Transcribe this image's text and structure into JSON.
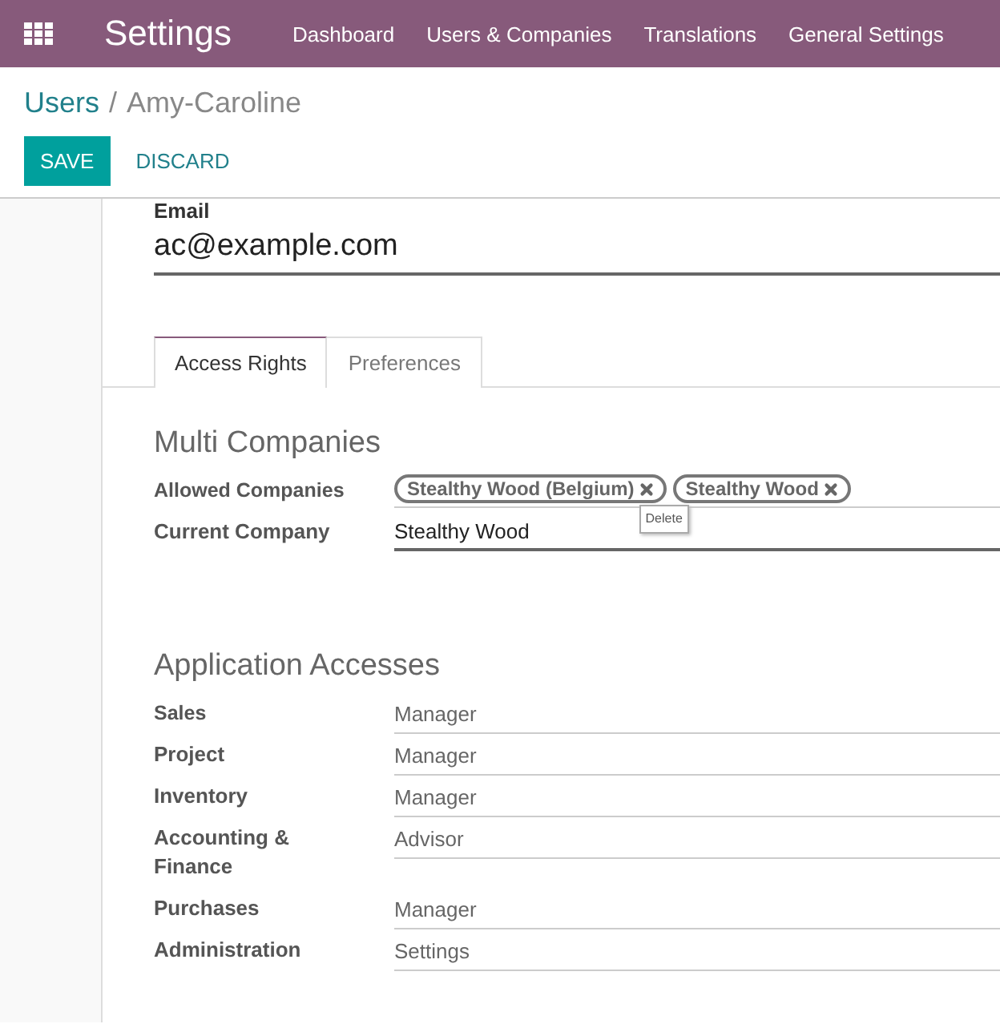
{
  "navbar": {
    "app_title": "Settings",
    "menu": [
      "Dashboard",
      "Users & Companies",
      "Translations",
      "General Settings"
    ]
  },
  "breadcrumb": {
    "parent": "Users",
    "separator": "/",
    "current": "Amy-Caroline"
  },
  "buttons": [
    {
      "label": "SAVE",
      "kind": "primary"
    },
    {
      "label": "DISCARD",
      "kind": "link"
    }
  ],
  "email": {
    "label": "Email",
    "value": "ac@example.com"
  },
  "tabs": [
    {
      "label": "Access Rights",
      "selected": true
    },
    {
      "label": "Preferences",
      "selected": false
    }
  ],
  "sections": [
    {
      "title": "Multi Companies",
      "fields": [
        {
          "label": "Allowed Companies",
          "kind": "tags",
          "tags": [
            {
              "label": "Stealthy Wood (Belgium)",
              "tooltip": "Delete"
            },
            {
              "label": "Stealthy Wood"
            }
          ]
        },
        {
          "label": "Current Company",
          "kind": "input",
          "value": "Stealthy Wood"
        }
      ]
    },
    {
      "title": "Application Accesses",
      "fields": [
        {
          "label": "Sales",
          "kind": "select",
          "value": "Manager"
        },
        {
          "label": "Project",
          "kind": "select",
          "value": "Manager"
        },
        {
          "label": "Inventory",
          "kind": "select",
          "value": "Manager"
        },
        {
          "label": "Accounting & Finance",
          "kind": "select",
          "value": "Advisor"
        },
        {
          "label": "Purchases",
          "kind": "select",
          "value": "Manager"
        },
        {
          "label": "Administration",
          "kind": "select",
          "value": "Settings"
        }
      ]
    }
  ]
}
